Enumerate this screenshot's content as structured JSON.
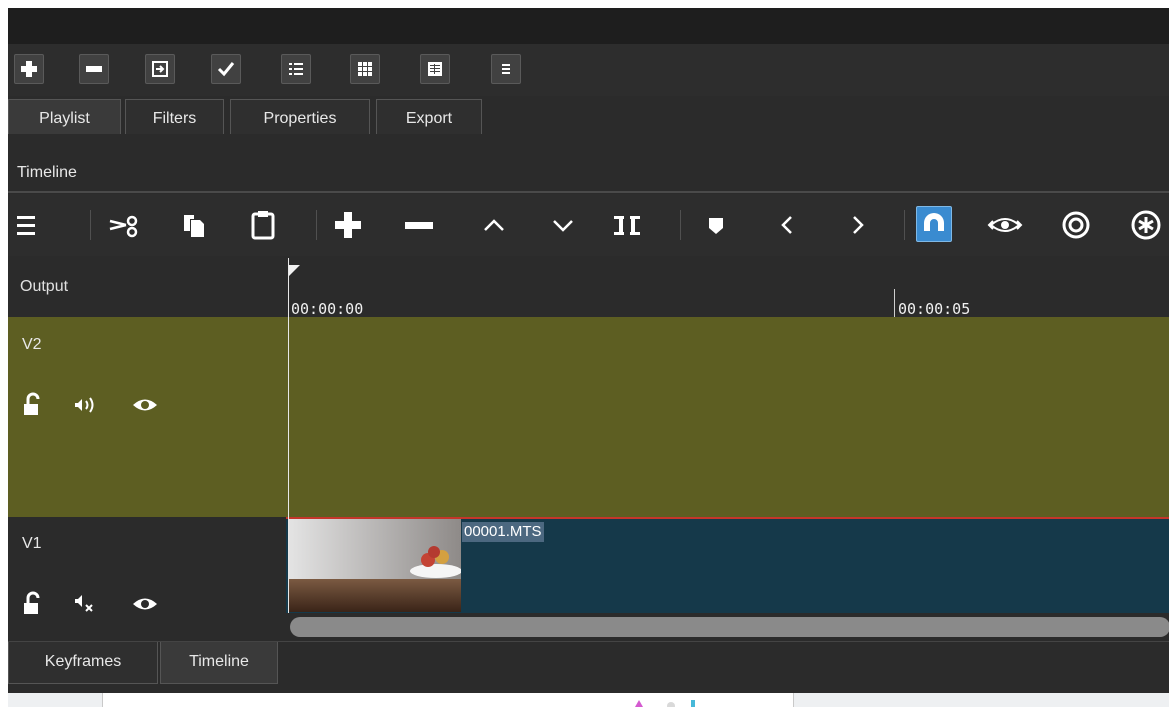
{
  "window": {
    "title": ""
  },
  "top_toolbar": {
    "buttons": [
      {
        "name": "add-button",
        "icon": "plus-icon"
      },
      {
        "name": "remove-button",
        "icon": "minus-icon"
      },
      {
        "name": "update-button",
        "icon": "update-icon"
      },
      {
        "name": "check-button",
        "icon": "check-icon"
      },
      {
        "name": "details-view-button",
        "icon": "list-icon"
      },
      {
        "name": "tiles-view-button",
        "icon": "grid-icon"
      },
      {
        "name": "icons-view-button",
        "icon": "table-icon"
      },
      {
        "name": "menu-button",
        "icon": "menu-icon"
      }
    ]
  },
  "tabs": [
    "Playlist",
    "Filters",
    "Properties",
    "Export"
  ],
  "timeline_label": "Timeline",
  "timeline_toolbar": {
    "icons": [
      "menu-icon",
      "cut-icon",
      "copy-icon",
      "paste-icon",
      "append-icon",
      "remove-icon",
      "lift-icon",
      "overwrite-icon",
      "split-icon",
      "marker-icon",
      "previous-marker-icon",
      "next-marker-icon",
      "snap-icon",
      "scrub-icon",
      "ripple-icon",
      "ripple-all-icon"
    ]
  },
  "tracks": {
    "output": "Output",
    "v2": "V2",
    "v1": "V1"
  },
  "ruler": {
    "t0": "00:00:00",
    "t5": "00:00:05"
  },
  "clip": {
    "name": "00001.MTS"
  },
  "bottom_tabs": [
    "Keyframes",
    "Timeline"
  ],
  "colors": {
    "v2_track": "#5d5e22",
    "v1_clip": "#15394a",
    "snap_active": "#3a8bd0"
  }
}
